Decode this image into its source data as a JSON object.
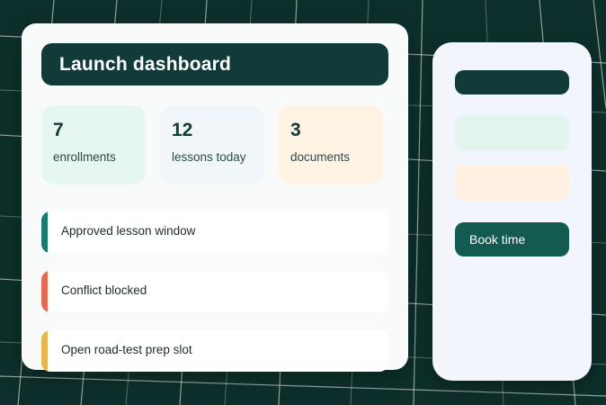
{
  "dashboard": {
    "title": "Launch dashboard",
    "stats": [
      {
        "value": "7",
        "label": "enrollments"
      },
      {
        "value": "12",
        "label": "lessons today"
      },
      {
        "value": "3",
        "label": "documents"
      }
    ],
    "events": [
      {
        "text": "Approved lesson window",
        "status_color": "#1a7a6d"
      },
      {
        "text": "Conflict blocked",
        "status_color": "#e46a55"
      },
      {
        "text": "Open road-test prep slot",
        "status_color": "#e9b54d"
      }
    ]
  },
  "side_panel": {
    "book_button_label": "Book time"
  },
  "colors": {
    "background": "#0d2f2b",
    "primary_dark": "#123a39",
    "button": "#135a51",
    "mint": "#e6f6f1",
    "peach": "#fff3e4"
  }
}
